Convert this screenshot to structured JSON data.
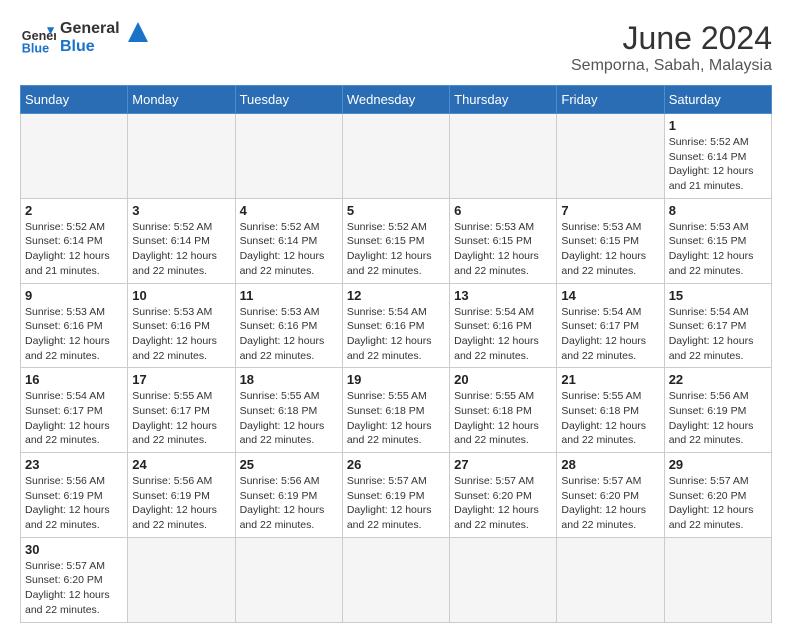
{
  "header": {
    "logo_general": "General",
    "logo_blue": "Blue",
    "month": "June 2024",
    "location": "Semporna, Sabah, Malaysia"
  },
  "weekdays": [
    "Sunday",
    "Monday",
    "Tuesday",
    "Wednesday",
    "Thursday",
    "Friday",
    "Saturday"
  ],
  "weeks": [
    [
      {
        "day": "",
        "info": ""
      },
      {
        "day": "",
        "info": ""
      },
      {
        "day": "",
        "info": ""
      },
      {
        "day": "",
        "info": ""
      },
      {
        "day": "",
        "info": ""
      },
      {
        "day": "",
        "info": ""
      },
      {
        "day": "1",
        "info": "Sunrise: 5:52 AM\nSunset: 6:14 PM\nDaylight: 12 hours\nand 21 minutes."
      }
    ],
    [
      {
        "day": "2",
        "info": "Sunrise: 5:52 AM\nSunset: 6:14 PM\nDaylight: 12 hours\nand 21 minutes."
      },
      {
        "day": "3",
        "info": "Sunrise: 5:52 AM\nSunset: 6:14 PM\nDaylight: 12 hours\nand 22 minutes."
      },
      {
        "day": "4",
        "info": "Sunrise: 5:52 AM\nSunset: 6:14 PM\nDaylight: 12 hours\nand 22 minutes."
      },
      {
        "day": "5",
        "info": "Sunrise: 5:52 AM\nSunset: 6:15 PM\nDaylight: 12 hours\nand 22 minutes."
      },
      {
        "day": "6",
        "info": "Sunrise: 5:53 AM\nSunset: 6:15 PM\nDaylight: 12 hours\nand 22 minutes."
      },
      {
        "day": "7",
        "info": "Sunrise: 5:53 AM\nSunset: 6:15 PM\nDaylight: 12 hours\nand 22 minutes."
      },
      {
        "day": "8",
        "info": "Sunrise: 5:53 AM\nSunset: 6:15 PM\nDaylight: 12 hours\nand 22 minutes."
      }
    ],
    [
      {
        "day": "9",
        "info": "Sunrise: 5:53 AM\nSunset: 6:16 PM\nDaylight: 12 hours\nand 22 minutes."
      },
      {
        "day": "10",
        "info": "Sunrise: 5:53 AM\nSunset: 6:16 PM\nDaylight: 12 hours\nand 22 minutes."
      },
      {
        "day": "11",
        "info": "Sunrise: 5:53 AM\nSunset: 6:16 PM\nDaylight: 12 hours\nand 22 minutes."
      },
      {
        "day": "12",
        "info": "Sunrise: 5:54 AM\nSunset: 6:16 PM\nDaylight: 12 hours\nand 22 minutes."
      },
      {
        "day": "13",
        "info": "Sunrise: 5:54 AM\nSunset: 6:16 PM\nDaylight: 12 hours\nand 22 minutes."
      },
      {
        "day": "14",
        "info": "Sunrise: 5:54 AM\nSunset: 6:17 PM\nDaylight: 12 hours\nand 22 minutes."
      },
      {
        "day": "15",
        "info": "Sunrise: 5:54 AM\nSunset: 6:17 PM\nDaylight: 12 hours\nand 22 minutes."
      }
    ],
    [
      {
        "day": "16",
        "info": "Sunrise: 5:54 AM\nSunset: 6:17 PM\nDaylight: 12 hours\nand 22 minutes."
      },
      {
        "day": "17",
        "info": "Sunrise: 5:55 AM\nSunset: 6:17 PM\nDaylight: 12 hours\nand 22 minutes."
      },
      {
        "day": "18",
        "info": "Sunrise: 5:55 AM\nSunset: 6:18 PM\nDaylight: 12 hours\nand 22 minutes."
      },
      {
        "day": "19",
        "info": "Sunrise: 5:55 AM\nSunset: 6:18 PM\nDaylight: 12 hours\nand 22 minutes."
      },
      {
        "day": "20",
        "info": "Sunrise: 5:55 AM\nSunset: 6:18 PM\nDaylight: 12 hours\nand 22 minutes."
      },
      {
        "day": "21",
        "info": "Sunrise: 5:55 AM\nSunset: 6:18 PM\nDaylight: 12 hours\nand 22 minutes."
      },
      {
        "day": "22",
        "info": "Sunrise: 5:56 AM\nSunset: 6:19 PM\nDaylight: 12 hours\nand 22 minutes."
      }
    ],
    [
      {
        "day": "23",
        "info": "Sunrise: 5:56 AM\nSunset: 6:19 PM\nDaylight: 12 hours\nand 22 minutes."
      },
      {
        "day": "24",
        "info": "Sunrise: 5:56 AM\nSunset: 6:19 PM\nDaylight: 12 hours\nand 22 minutes."
      },
      {
        "day": "25",
        "info": "Sunrise: 5:56 AM\nSunset: 6:19 PM\nDaylight: 12 hours\nand 22 minutes."
      },
      {
        "day": "26",
        "info": "Sunrise: 5:57 AM\nSunset: 6:19 PM\nDaylight: 12 hours\nand 22 minutes."
      },
      {
        "day": "27",
        "info": "Sunrise: 5:57 AM\nSunset: 6:20 PM\nDaylight: 12 hours\nand 22 minutes."
      },
      {
        "day": "28",
        "info": "Sunrise: 5:57 AM\nSunset: 6:20 PM\nDaylight: 12 hours\nand 22 minutes."
      },
      {
        "day": "29",
        "info": "Sunrise: 5:57 AM\nSunset: 6:20 PM\nDaylight: 12 hours\nand 22 minutes."
      }
    ],
    [
      {
        "day": "30",
        "info": "Sunrise: 5:57 AM\nSunset: 6:20 PM\nDaylight: 12 hours\nand 22 minutes."
      },
      {
        "day": "",
        "info": ""
      },
      {
        "day": "",
        "info": ""
      },
      {
        "day": "",
        "info": ""
      },
      {
        "day": "",
        "info": ""
      },
      {
        "day": "",
        "info": ""
      },
      {
        "day": "",
        "info": ""
      }
    ]
  ]
}
